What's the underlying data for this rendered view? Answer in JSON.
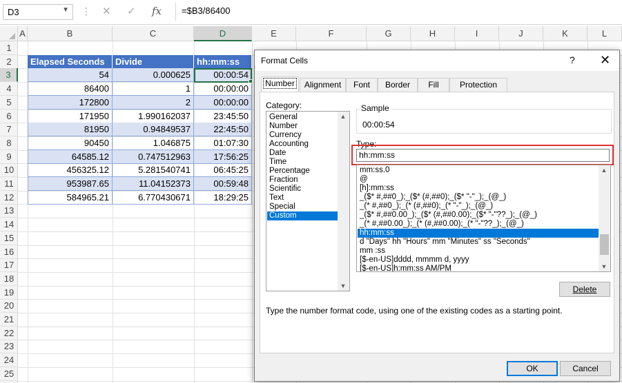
{
  "formula_bar": {
    "name_box": "D3",
    "cancel_icon": "✕",
    "enter_icon": "✓",
    "fx_label": "fx",
    "formula": "=$B3/86400"
  },
  "columns": [
    "A",
    "B",
    "C",
    "D",
    "E",
    "F",
    "G",
    "H",
    "I",
    "J",
    "K",
    "L"
  ],
  "rows": [
    "1",
    "2",
    "3",
    "4",
    "5",
    "6",
    "7",
    "8",
    "9",
    "10",
    "11",
    "12",
    "13",
    "14",
    "15",
    "16",
    "17",
    "18",
    "19",
    "20",
    "21",
    "22",
    "23",
    "24",
    "25"
  ],
  "table": {
    "headers": [
      "Elapsed Seconds",
      "Divide",
      "hh:mm:ss"
    ],
    "rows": [
      [
        "54",
        "0.000625",
        "00:00:54"
      ],
      [
        "86400",
        "1",
        "00:00:00"
      ],
      [
        "172800",
        "2",
        "00:00:00"
      ],
      [
        "171950",
        "1.990162037",
        "23:45:50"
      ],
      [
        "81950",
        "0.94849537",
        "22:45:50"
      ],
      [
        "90450",
        "1.046875",
        "01:07:30"
      ],
      [
        "64585.12",
        "0.747512963",
        "17:56:25"
      ],
      [
        "456325.12",
        "5.281540741",
        "06:45:25"
      ],
      [
        "953987.65",
        "11.04152373",
        "00:59:48"
      ],
      [
        "584965.21",
        "6.770430671",
        "18:29:25"
      ]
    ]
  },
  "dialog": {
    "title": "Format Cells",
    "help": "?",
    "close": "✕",
    "tabs": [
      "Number",
      "Alignment",
      "Font",
      "Border",
      "Fill",
      "Protection"
    ],
    "category_label": "Category:",
    "categories": [
      "General",
      "Number",
      "Currency",
      "Accounting",
      "Date",
      "Time",
      "Percentage",
      "Fraction",
      "Scientific",
      "Text",
      "Special",
      "Custom"
    ],
    "selected_category": "Custom",
    "sample_label": "Sample",
    "sample_value": "00:00:54",
    "type_label": "Type:",
    "type_value": "hh:mm:ss",
    "formats": [
      "mm:ss.0",
      "@",
      "[h]:mm:ss",
      "_($* #,##0_);_($* (#,##0);_($* \"-\"_);_(@_)",
      "_(* #,##0_);_(* (#,##0);_(* \"-\"_);_(@_)",
      "_($* #,##0.00_);_($* (#,##0.00);_($* \"-\"??_);_(@_)",
      "_(* #,##0.00_);_(* (#,##0.00);_(* \"-\"??_);_(@_)",
      "hh:mm:ss",
      "d \"Days\" hh \"Hours\" mm \"Minutes\" ss \"Seconds\"",
      "mm :ss",
      "[$-en-US]dddd, mmmm d, yyyy",
      "[$-en-US]h:mm:ss AM/PM"
    ],
    "selected_format": "hh:mm:ss",
    "delete_label": "Delete",
    "description": "Type the number format code, using one of the existing codes as a starting point.",
    "ok_label": "OK",
    "cancel_label": "Cancel"
  }
}
